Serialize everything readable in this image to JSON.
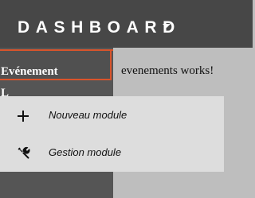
{
  "header": {
    "brand": "DASHBOARD"
  },
  "sidebar": {
    "items": [
      {
        "label": "Evénement"
      },
      {
        "label": "L"
      }
    ]
  },
  "main": {
    "text": "evenements works!"
  },
  "dropdown": {
    "items": [
      {
        "label": "Nouveau module",
        "icon": "plus-icon"
      },
      {
        "label": "Gestion module",
        "icon": "wrench-icon"
      }
    ]
  },
  "colors": {
    "topbar": "#474747",
    "sidebar": "#555555",
    "accent": "#d9542b",
    "content": "#bebebe",
    "menu": "#dddddd"
  }
}
